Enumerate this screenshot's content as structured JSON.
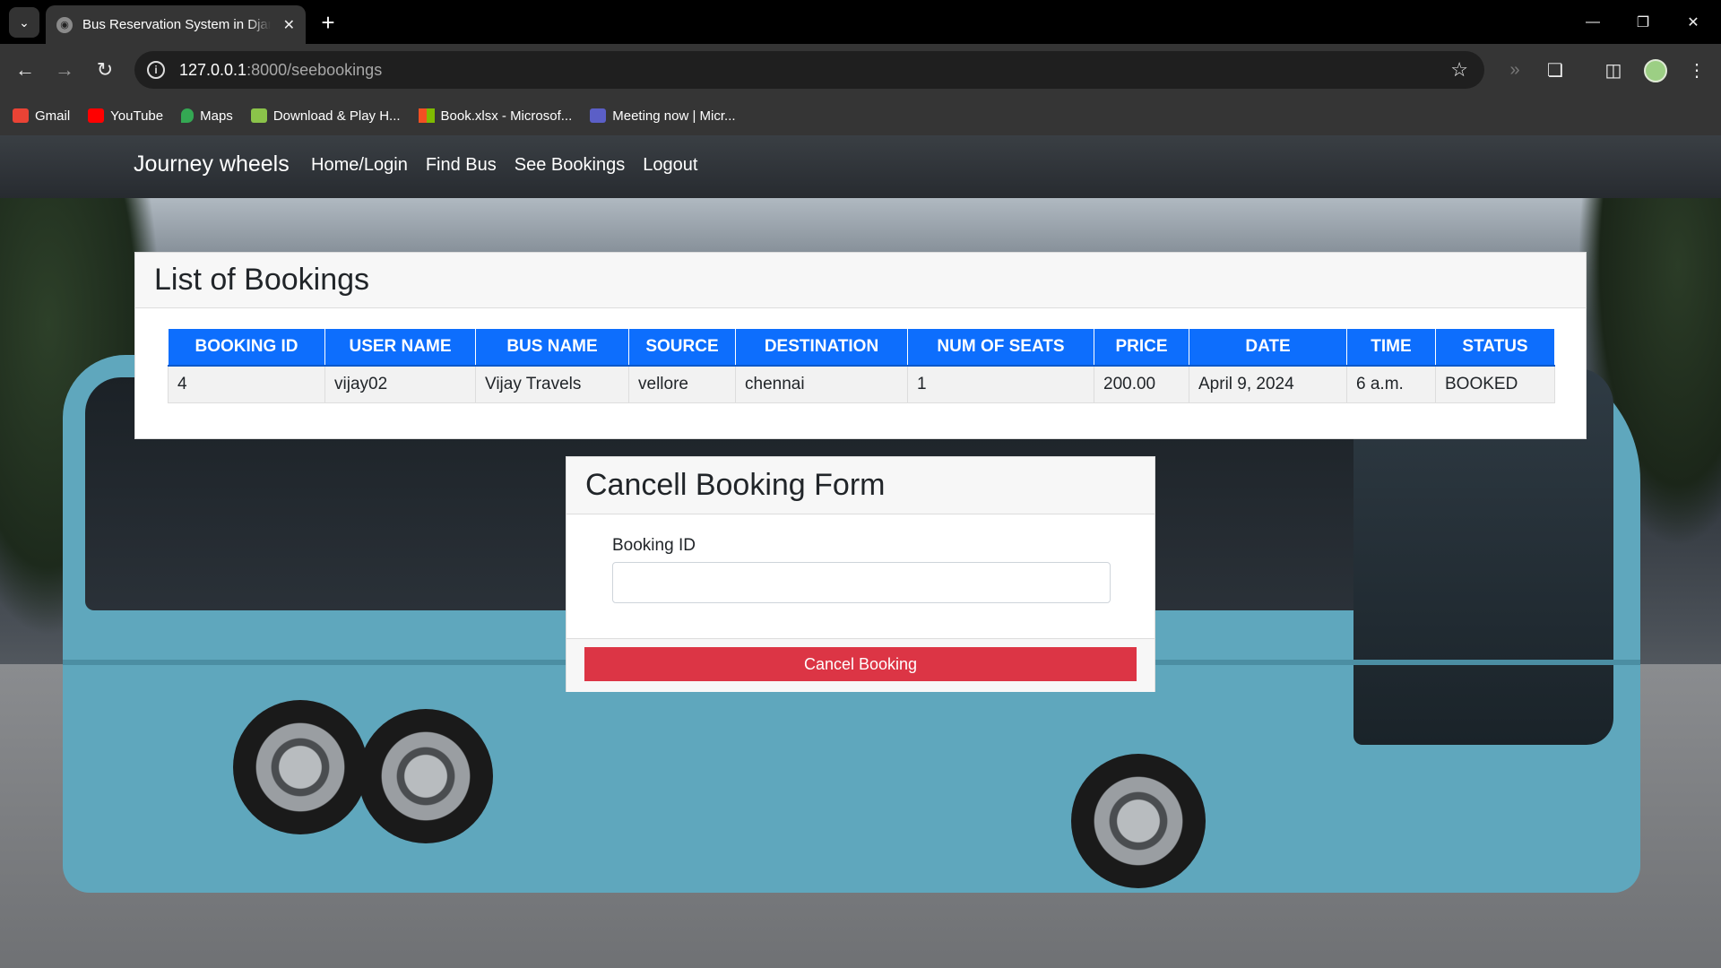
{
  "browser": {
    "tab_title": "Bus Reservation System in Django",
    "url_host": "127.0.0.1",
    "url_path": ":8000/seebookings",
    "bookmarks": [
      {
        "label": "Gmail",
        "color": "#ea4335"
      },
      {
        "label": "YouTube",
        "color": "#ff0000"
      },
      {
        "label": "Maps",
        "color": "#34a853"
      },
      {
        "label": "Download & Play H...",
        "color": "#8bc34a"
      },
      {
        "label": "Book.xlsx - Microsof...",
        "color": "#f25022"
      },
      {
        "label": "Meeting now | Micr...",
        "color": "#5b5fc7"
      }
    ]
  },
  "site": {
    "brand": "Journey wheels",
    "nav": [
      "Home/Login",
      "Find Bus",
      "See Bookings",
      "Logout"
    ]
  },
  "bookings": {
    "title": "List of Bookings",
    "columns": [
      "BOOKING ID",
      "USER NAME",
      "BUS NAME",
      "SOURCE",
      "DESTINATION",
      "NUM OF SEATS",
      "PRICE",
      "DATE",
      "TIME",
      "STATUS"
    ],
    "rows": [
      [
        "4",
        "vijay02",
        "Vijay Travels",
        "vellore",
        "chennai",
        "1",
        "200.00",
        "April 9, 2024",
        "6 a.m.",
        "BOOKED"
      ]
    ]
  },
  "cancel_form": {
    "title": "Cancell Booking Form",
    "label": "Booking ID",
    "input_value": "",
    "button_label": "Cancel Booking"
  },
  "colors": {
    "header_blue": "#0d6efd",
    "danger_red": "#dc3545"
  }
}
